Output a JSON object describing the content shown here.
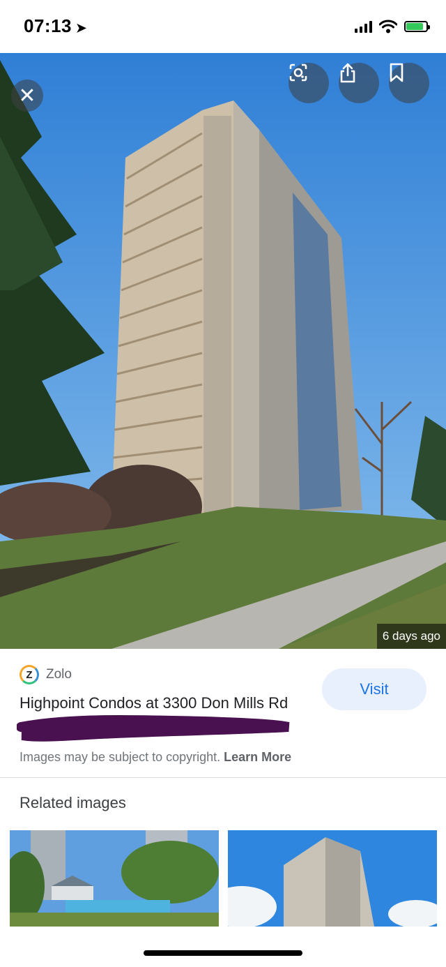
{
  "status": {
    "time": "07:13"
  },
  "image": {
    "age": "6 days ago"
  },
  "result": {
    "source_name": "Zolo",
    "source_logo_letter": "Z",
    "title": "Highpoint Condos at 3300 Don Mills Rd",
    "visit_label": "Visit",
    "copyright_text": "Images may be subject to copyright. ",
    "learn_more": "Learn More"
  },
  "related": {
    "title": "Related images"
  },
  "colors": {
    "accent": "#1a73e8",
    "visit_bg": "#e8f0fe",
    "battery": "#34c759"
  },
  "icons": [
    "location-arrow-icon",
    "signal-icon",
    "wifi-icon",
    "battery-icon",
    "close-icon",
    "lens-icon",
    "share-icon",
    "bookmark-icon"
  ]
}
